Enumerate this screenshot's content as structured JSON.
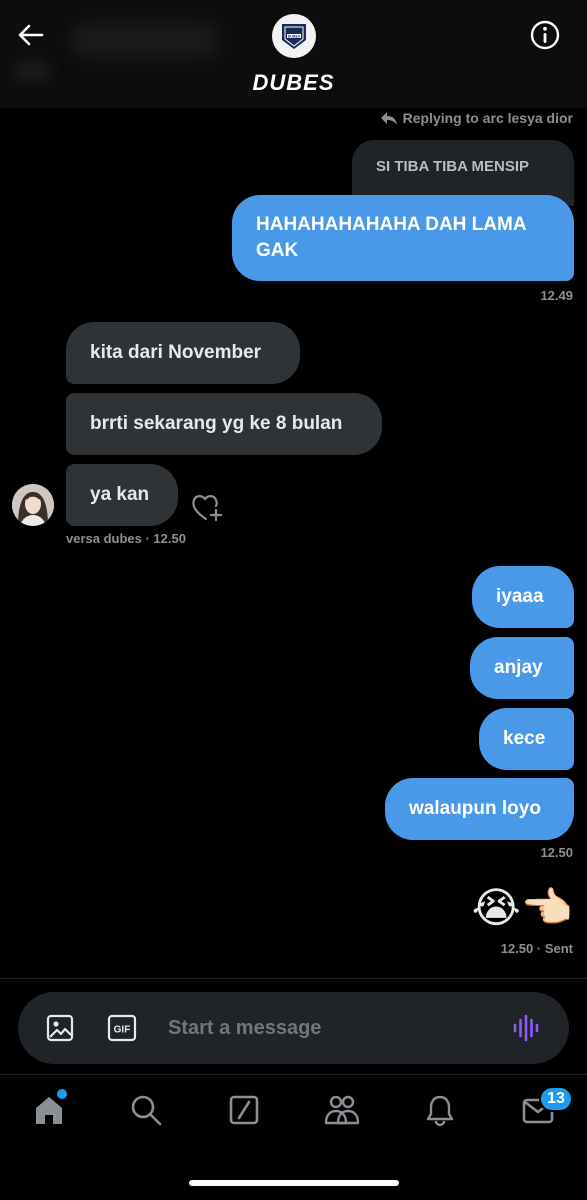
{
  "header": {
    "group_name": "DUBES",
    "avatar_text": "DUBES",
    "back_icon": "arrow-left-icon",
    "info_icon": "info-circle-icon"
  },
  "reply": {
    "hint": "Replying to arc lesya dior",
    "quoted_text": "SI TIBA TIBA MENSIP"
  },
  "messages": {
    "m1": {
      "text": "HAHAHAHAHAHA DAH LAMA GAK",
      "time": "12.49"
    },
    "m2": {
      "text": "kita dari November"
    },
    "m3": {
      "text": "brrti sekarang yg ke 8 bulan"
    },
    "m4": {
      "text": "ya kan",
      "meta": "versa dubes · 12.50"
    },
    "m5": {
      "text": "iyaaa"
    },
    "m6": {
      "text": "anjay"
    },
    "m7": {
      "text": "kece"
    },
    "m8": {
      "text": "walaupun loyo",
      "time": "12.50"
    },
    "m9": {
      "emoji": "😭👈🏻",
      "time": "12.50 · Sent"
    }
  },
  "composer": {
    "placeholder": "Start a message",
    "gif_label": "GIF"
  },
  "nav": {
    "items": [
      "home-icon",
      "search-icon",
      "grok-icon",
      "communities-icon",
      "notifications-bell-icon",
      "messages-mail-icon"
    ],
    "messages_badge": "13"
  },
  "colors": {
    "outgoing_bubble": "#4a99e9",
    "incoming_bubble": "#2f3336",
    "accent": "#1d9bf0",
    "voice_icon": "#8b5cf6"
  }
}
